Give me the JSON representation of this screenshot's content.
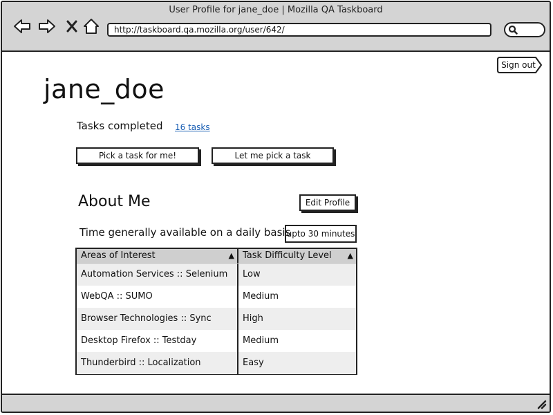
{
  "window": {
    "title": "User Profile for jane_doe | Mozilla QA Taskboard"
  },
  "browser": {
    "url": "http://taskboard.qa.mozilla.org/user/642/",
    "icons": [
      "back-icon",
      "forward-icon",
      "close-icon",
      "home-icon",
      "search-icon"
    ]
  },
  "header": {
    "signout_label": "Sign out"
  },
  "profile": {
    "username": "jane_doe",
    "tasks_label": "Tasks completed",
    "tasks_link": "16 tasks",
    "pick_for_me_label": "Pick a task for me!",
    "let_me_pick_label": "Let me pick a task"
  },
  "about": {
    "title": "About Me",
    "edit_label": "Edit Profile",
    "time_label": "Time generally available on a daily basis",
    "time_value": "upto 30 minutes"
  },
  "interests": {
    "columns": [
      "Areas of Interest",
      "Task Difficulty Level"
    ],
    "rows": [
      [
        "Automation Services :: Selenium",
        "Low"
      ],
      [
        "WebQA :: SUMO",
        "Medium"
      ],
      [
        "Browser Technologies :: Sync",
        "High"
      ],
      [
        "Desktop Firefox :: Testday",
        "Medium"
      ],
      [
        "Thunderbird :: Localization",
        "Easy"
      ]
    ]
  }
}
